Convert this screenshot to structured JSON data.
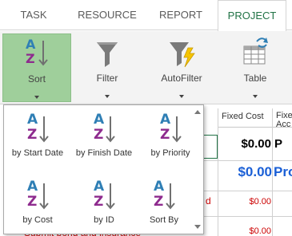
{
  "tabs": [
    "TASK",
    "RESOURCE",
    "REPORT",
    "PROJECT"
  ],
  "active_tab": "PROJECT",
  "ribbon": {
    "sort": "Sort",
    "filter": "Filter",
    "autofilter": "AutoFilter",
    "table": "Table"
  },
  "sort_menu": {
    "items": [
      "by Start Date",
      "by Finish Date",
      "by Priority",
      "by Cost",
      "by ID",
      "Sort By"
    ]
  },
  "sheet": {
    "col_fixed_cost": "Fixed Cost",
    "col_fixed_acc_line1": "Fixe",
    "col_fixed_acc_line2": "Acc",
    "row1_cost": "$0.00",
    "row1_acc": "P",
    "row2_cost": "$0.00",
    "row2_acc": "Pro",
    "row3_cost": "$0.00",
    "row3_mark": "d",
    "row4_cost": "$0.00",
    "row4_task": "Submit bond and insurance"
  },
  "colors": {
    "sort_active_bg": "#9fcf9b",
    "project_tab_text": "#217346",
    "az_blue": "#2f7fb5",
    "az_purple": "#8e2b8e",
    "summary_blue": "#1a5fd6",
    "critical_red": "#cc0000"
  },
  "icons": [
    "sort-az-icon",
    "filter-funnel-icon",
    "autofilter-funnel-icon",
    "table-grid-icon"
  ]
}
